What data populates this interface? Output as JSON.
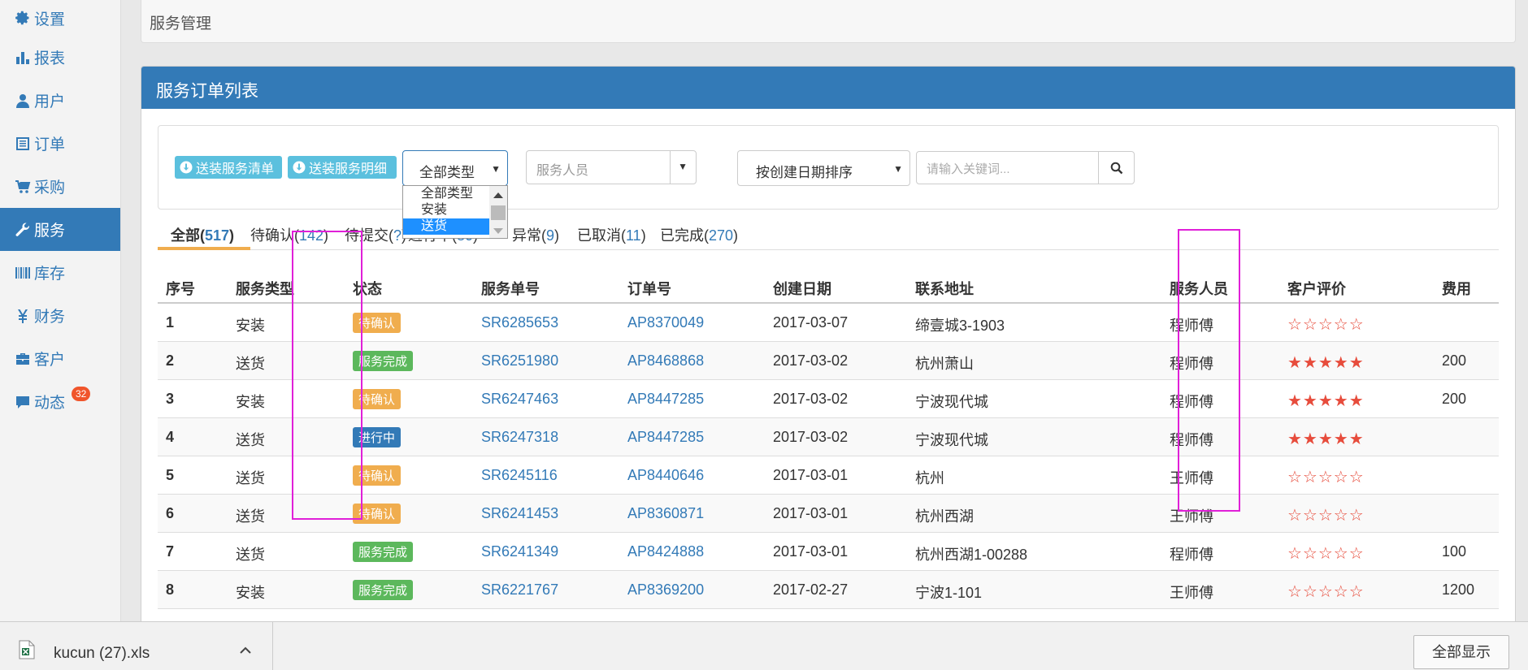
{
  "sidebar": {
    "items": [
      {
        "label": "设置",
        "icon": "gear-icon"
      },
      {
        "label": "报表",
        "icon": "bar-chart-icon"
      },
      {
        "label": "用户",
        "icon": "user-icon"
      },
      {
        "label": "订单",
        "icon": "list-icon"
      },
      {
        "label": "采购",
        "icon": "cart-icon"
      },
      {
        "label": "服务",
        "icon": "wrench-icon",
        "active": true
      },
      {
        "label": "库存",
        "icon": "barcode-icon"
      },
      {
        "label": "财务",
        "icon": "yen-icon"
      },
      {
        "label": "客户",
        "icon": "briefcase-icon"
      },
      {
        "label": "动态",
        "icon": "comment-icon",
        "badge": "32"
      }
    ],
    "active_color": "#337ab7"
  },
  "breadcrumb": "服务管理",
  "panel": {
    "title": "服务订单列表"
  },
  "toolbar": {
    "btn_list": "送装服务清单",
    "btn_detail": "送装服务明细",
    "type_select": {
      "value": "全部类型",
      "options": [
        "全部类型",
        "安装",
        "送货"
      ],
      "highlighted": "送货"
    },
    "staff_placeholder": "服务人员",
    "sort_value": "按创建日期排序",
    "search_placeholder": "请输入关键词..."
  },
  "tabs": [
    {
      "label": "全部",
      "count": "517"
    },
    {
      "label": "待确认",
      "count": "142"
    },
    {
      "label": "待提交",
      "count": "?"
    },
    {
      "label": "进行中",
      "count": "80"
    },
    {
      "label": "异常",
      "count": "9"
    },
    {
      "label": "已取消",
      "count": "11"
    },
    {
      "label": "已完成",
      "count": "270"
    }
  ],
  "table": {
    "headers": [
      "序号",
      "服务类型",
      "状态",
      "服务单号",
      "订单号",
      "创建日期",
      "联系地址",
      "服务人员",
      "客户评价",
      "费用"
    ],
    "rows": [
      {
        "no": "1",
        "type": "安装",
        "status": "待确认",
        "status_kind": "warning",
        "sr": "SR6285653",
        "ap": "AP8370049",
        "date": "2017-03-07",
        "addr": "缔壹城3-1903",
        "staff": "程师傅",
        "rating": 0,
        "fee": ""
      },
      {
        "no": "2",
        "type": "送货",
        "status": "服务完成",
        "status_kind": "success",
        "sr": "SR6251980",
        "ap": "AP8468868",
        "date": "2017-03-02",
        "addr": "杭州萧山",
        "staff": "程师傅",
        "rating": 5,
        "fee": "200"
      },
      {
        "no": "3",
        "type": "安装",
        "status": "待确认",
        "status_kind": "warning",
        "sr": "SR6247463",
        "ap": "AP8447285",
        "date": "2017-03-02",
        "addr": "宁波现代城",
        "staff": "程师傅",
        "rating": 5,
        "fee": "200"
      },
      {
        "no": "4",
        "type": "送货",
        "status": "进行中",
        "status_kind": "primary",
        "sr": "SR6247318",
        "ap": "AP8447285",
        "date": "2017-03-02",
        "addr": "宁波现代城",
        "staff": "程师傅",
        "rating": 5,
        "fee": ""
      },
      {
        "no": "5",
        "type": "送货",
        "status": "待确认",
        "status_kind": "warning",
        "sr": "SR6245116",
        "ap": "AP8440646",
        "date": "2017-03-01",
        "addr": "杭州",
        "staff": "王师傅",
        "rating": 0,
        "fee": ""
      },
      {
        "no": "6",
        "type": "送货",
        "status": "待确认",
        "status_kind": "warning",
        "sr": "SR6241453",
        "ap": "AP8360871",
        "date": "2017-03-01",
        "addr": "杭州西湖",
        "staff": "王师傅",
        "rating": 0,
        "fee": ""
      },
      {
        "no": "7",
        "type": "送货",
        "status": "服务完成",
        "status_kind": "success",
        "sr": "SR6241349",
        "ap": "AP8424888",
        "date": "2017-03-01",
        "addr": "杭州西湖1-00288",
        "staff": "程师傅",
        "rating": 0,
        "fee": "100"
      },
      {
        "no": "8",
        "type": "安装",
        "status": "服务完成",
        "status_kind": "success",
        "sr": "SR6221767",
        "ap": "AP8369200",
        "date": "2017-02-27",
        "addr": "宁波1-101",
        "staff": "王师傅",
        "rating": 0,
        "fee": "1200"
      }
    ]
  },
  "download": {
    "filename": "kucun (27).xls",
    "show_all": "全部显示"
  },
  "colors": {
    "primary": "#337ab7",
    "info": "#5bc0de",
    "warning": "#f0ad4e",
    "success": "#5cb85c",
    "star": "#e74c3c",
    "highlight": "#e020d8"
  }
}
